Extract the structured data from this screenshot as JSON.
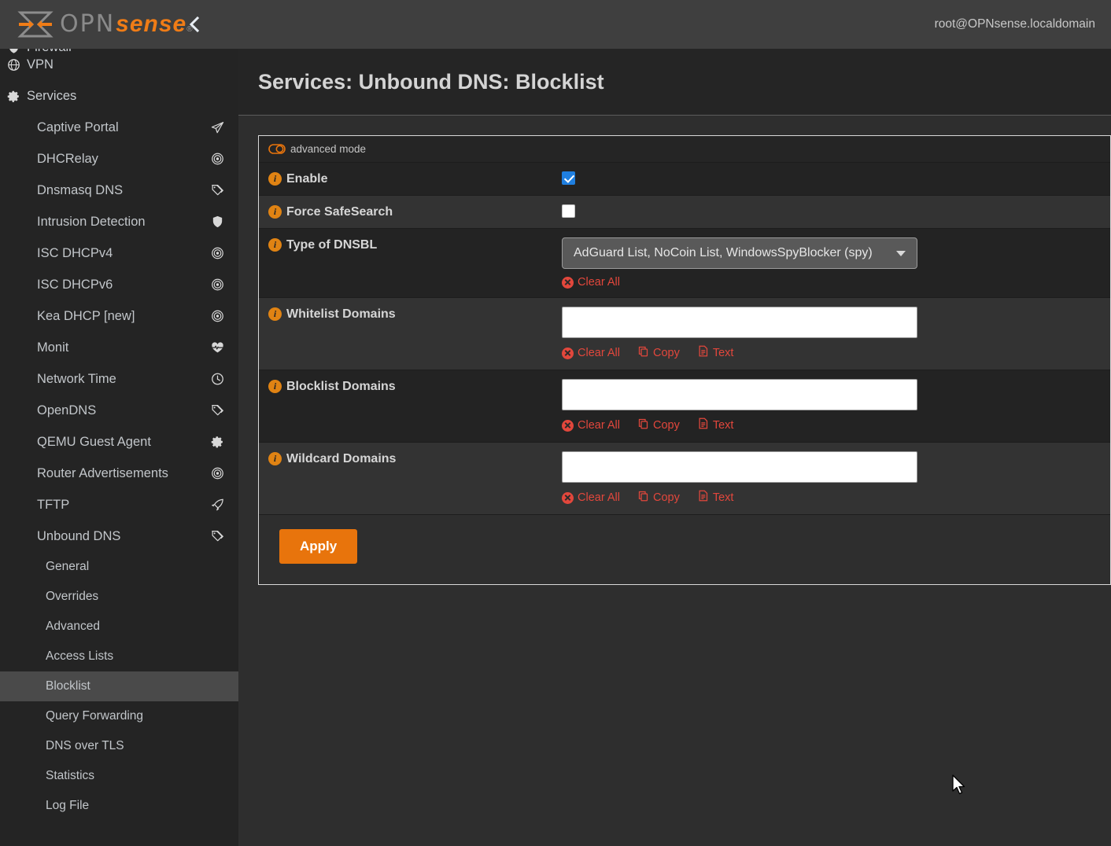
{
  "header": {
    "logo_opn": "OPN",
    "logo_sense": "sense",
    "logo_reg": "®",
    "collapse_icon": "chevron-left-icon",
    "user": "root@OPNsense.localdomain"
  },
  "sidebar": {
    "items": [
      {
        "label": "Firewall",
        "level": 1,
        "left_icon": "shield-icon",
        "right_icon": "",
        "active": false
      },
      {
        "label": "VPN",
        "level": 1,
        "left_icon": "globe-icon",
        "right_icon": "",
        "active": false
      },
      {
        "label": "Services",
        "level": 1,
        "left_icon": "gear-icon",
        "right_icon": "",
        "active": false
      },
      {
        "label": "Captive Portal",
        "level": 2,
        "left_icon": "",
        "right_icon": "paper-plane-icon",
        "active": false
      },
      {
        "label": "DHCRelay",
        "level": 2,
        "left_icon": "",
        "right_icon": "bullseye-icon",
        "active": false
      },
      {
        "label": "Dnsmasq DNS",
        "level": 2,
        "left_icon": "",
        "right_icon": "tags-icon",
        "active": false
      },
      {
        "label": "Intrusion Detection",
        "level": 2,
        "left_icon": "",
        "right_icon": "shield-icon",
        "active": false
      },
      {
        "label": "ISC DHCPv4",
        "level": 2,
        "left_icon": "",
        "right_icon": "bullseye-icon",
        "active": false
      },
      {
        "label": "ISC DHCPv6",
        "level": 2,
        "left_icon": "",
        "right_icon": "bullseye-icon",
        "active": false
      },
      {
        "label": "Kea DHCP [new]",
        "level": 2,
        "left_icon": "",
        "right_icon": "bullseye-icon",
        "active": false
      },
      {
        "label": "Monit",
        "level": 2,
        "left_icon": "",
        "right_icon": "heartbeat-icon",
        "active": false
      },
      {
        "label": "Network Time",
        "level": 2,
        "left_icon": "",
        "right_icon": "clock-icon",
        "active": false
      },
      {
        "label": "OpenDNS",
        "level": 2,
        "left_icon": "",
        "right_icon": "tags-icon",
        "active": false
      },
      {
        "label": "QEMU Guest Agent",
        "level": 2,
        "left_icon": "",
        "right_icon": "gear-icon",
        "active": false
      },
      {
        "label": "Router Advertisements",
        "level": 2,
        "left_icon": "",
        "right_icon": "bullseye-icon",
        "active": false
      },
      {
        "label": "TFTP",
        "level": 2,
        "left_icon": "",
        "right_icon": "rocket-icon",
        "active": false
      },
      {
        "label": "Unbound DNS",
        "level": 2,
        "left_icon": "",
        "right_icon": "tags-icon",
        "active": false
      },
      {
        "label": "General",
        "level": 3,
        "left_icon": "",
        "right_icon": "",
        "active": false
      },
      {
        "label": "Overrides",
        "level": 3,
        "left_icon": "",
        "right_icon": "",
        "active": false
      },
      {
        "label": "Advanced",
        "level": 3,
        "left_icon": "",
        "right_icon": "",
        "active": false
      },
      {
        "label": "Access Lists",
        "level": 3,
        "left_icon": "",
        "right_icon": "",
        "active": false
      },
      {
        "label": "Blocklist",
        "level": 3,
        "left_icon": "",
        "right_icon": "",
        "active": true
      },
      {
        "label": "Query Forwarding",
        "level": 3,
        "left_icon": "",
        "right_icon": "",
        "active": false
      },
      {
        "label": "DNS over TLS",
        "level": 3,
        "left_icon": "",
        "right_icon": "",
        "active": false
      },
      {
        "label": "Statistics",
        "level": 3,
        "left_icon": "",
        "right_icon": "",
        "active": false
      },
      {
        "label": "Log File",
        "level": 3,
        "left_icon": "",
        "right_icon": "",
        "active": false
      }
    ]
  },
  "page": {
    "title": "Services: Unbound DNS: Blocklist",
    "advanced_mode_label": "advanced mode"
  },
  "form": {
    "rows": [
      {
        "label": "Enable",
        "control": "checkbox",
        "checked": true
      },
      {
        "label": "Force SafeSearch",
        "control": "checkbox",
        "checked": false
      },
      {
        "label": "Type of DNSBL",
        "control": "select",
        "value": "AdGuard List, NoCoin List, WindowsSpyBlocker (spy)"
      },
      {
        "label": "Whitelist Domains",
        "control": "textbox",
        "value": ""
      },
      {
        "label": "Blocklist Domains",
        "control": "textbox",
        "value": ""
      },
      {
        "label": "Wildcard Domains",
        "control": "textbox",
        "value": ""
      }
    ],
    "actions": {
      "clear_all": "Clear All",
      "copy": "Copy",
      "text": "Text"
    },
    "apply_label": "Apply"
  },
  "colors": {
    "accent": "#e8740c",
    "link_red": "#e2473c",
    "info_orange": "#e08313",
    "checkbox_blue": "#1f7fe0",
    "sidebar_bg": "#242424",
    "content_bg": "#2e2e2e"
  }
}
